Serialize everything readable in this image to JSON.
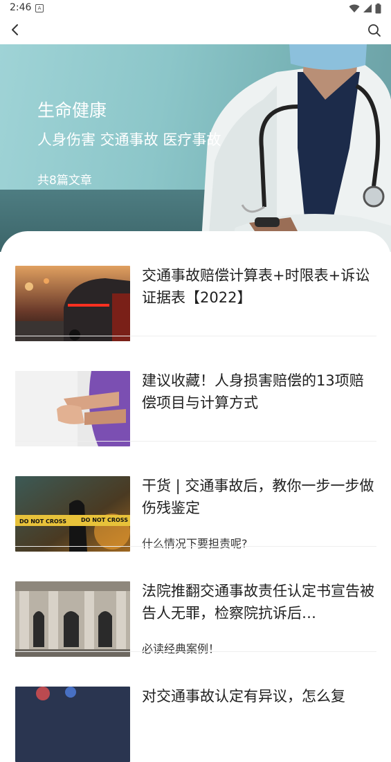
{
  "status_bar": {
    "time": "2:46",
    "app_icon": "A"
  },
  "hero": {
    "title": "生命健康",
    "subtitle": "人身伤害 交通事故 医疗事故",
    "count": "共8篇文章"
  },
  "articles": [
    {
      "title": "交通事故赔偿计算表+时限表+诉讼证据表【2022】",
      "subtitle": ""
    },
    {
      "title": "建议收藏！人身损害赔偿的13项赔偿项目与计算方式",
      "subtitle": ""
    },
    {
      "title": "干货 | 交通事故后，教你一步一步做伤残鉴定",
      "subtitle": "什么情况下要担责呢?"
    },
    {
      "title": "法院推翻交通事故责任认定书宣告被告人无罪，检察院抗诉后…",
      "subtitle": "必读经典案例！"
    },
    {
      "title": "对交通事故认定有异议，怎么复",
      "subtitle": ""
    }
  ],
  "thumb_labels": {
    "tape_1": "DO NOT CROSS",
    "tape_2": "DO NOT CROSS"
  },
  "icons": {
    "back": "chevron-left-icon",
    "search": "search-icon",
    "wifi": "wifi-icon",
    "signal": "signal-icon",
    "battery": "battery-icon"
  }
}
